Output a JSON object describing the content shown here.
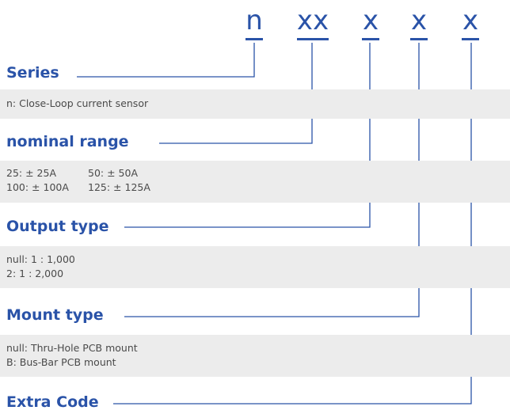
{
  "header": {
    "codes": [
      "n",
      "xx",
      "x",
      "x",
      "x"
    ]
  },
  "sections": [
    {
      "title": "Series",
      "lines": [
        "n: Close-Loop current sensor"
      ]
    },
    {
      "title": "nominal range",
      "rows": [
        [
          "25: ± 25A",
          "50: ± 50A"
        ],
        [
          "100: ± 100A",
          "125: ± 125A"
        ]
      ]
    },
    {
      "title": "Output type",
      "lines": [
        "null: 1 : 1,000",
        "2: 1 : 2,000"
      ]
    },
    {
      "title": "Mount type",
      "lines": [
        "null: Thru-Hole PCB mount",
        "B: Bus-Bar PCB mount"
      ]
    },
    {
      "title": "Extra Code"
    }
  ],
  "colors": {
    "accent": "#2a53a8",
    "band": "#ececec",
    "text": "#4a4a4a"
  }
}
